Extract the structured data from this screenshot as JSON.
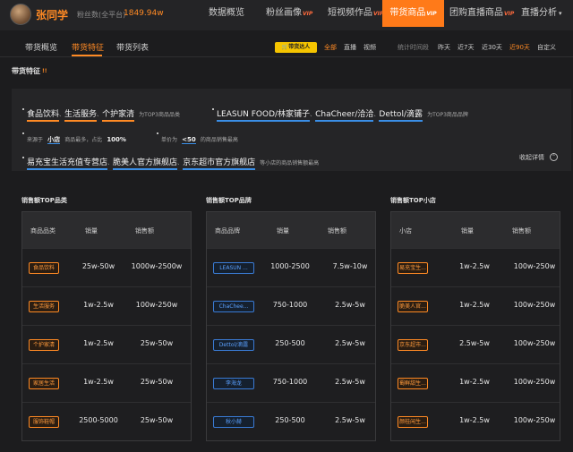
{
  "colors": {
    "accent": "#ff8a24",
    "blue": "#3a8ee6",
    "bg": "#1c1c1e"
  },
  "profile": {
    "name": "张同学",
    "fans_label": "粉丝数(全平台)",
    "fans_value": "1849.94w"
  },
  "nav": {
    "vip": "VIP",
    "items": [
      {
        "label": "数据概览"
      },
      {
        "label": "粉丝画像"
      },
      {
        "label": "短视频作品"
      },
      {
        "label": "带货商品"
      },
      {
        "label": "团购直播商品"
      },
      {
        "label": "直播分析"
      }
    ]
  },
  "subnav": {
    "tabs": [
      "带货概览",
      "带货特征",
      "带货列表"
    ],
    "badge": "带货达人",
    "filters": [
      "全部",
      "直播",
      "视频"
    ],
    "time_label": "统计时间段",
    "times": [
      "昨天",
      "近7天",
      "近30天",
      "近90天",
      "自定义"
    ]
  },
  "section": {
    "title": "带货特征",
    "mark": "!!"
  },
  "features": {
    "line1": {
      "cats": [
        "食品饮料",
        "生活服务",
        "个护家清"
      ],
      "sep": "、",
      "cats_suffix": "为TOP3商品品类",
      "brands": [
        "LEASUN FOOD/林家铺子",
        "ChaCheer/洽洽",
        "Dettol/滴露"
      ],
      "brands_suffix": "为TOP3商品品牌"
    },
    "line2": {
      "source_prefix": "来源于",
      "source_word": "小店",
      "source_mid": "商品最多，占比",
      "source_pct": "100%",
      "price_prefix": "单价为",
      "price": "<50",
      "price_suffix": "的商品销售最高"
    },
    "line3": {
      "shops": [
        "易充宝生活充值专营店",
        "脆美人官方旗舰店",
        "京东超市官方旗舰店"
      ],
      "suffix": "等小店的商品销售额最高"
    },
    "collapse": "收起详情",
    "collapse_icon": "chevron-up-icon"
  },
  "tables": [
    {
      "title": "销售额TOP品类",
      "headers": [
        "商品品类",
        "销量",
        "销售额"
      ],
      "rows": [
        {
          "tag": "食品饮料",
          "sales": "25w-50w",
          "amount": "1000w-2500w"
        },
        {
          "tag": "生活服务",
          "sales": "1w-2.5w",
          "amount": "100w-250w"
        },
        {
          "tag": "个护家清",
          "sales": "1w-2.5w",
          "amount": "25w-50w"
        },
        {
          "tag": "家居生活",
          "sales": "1w-2.5w",
          "amount": "25w-50w"
        },
        {
          "tag": "服饰鞋帽",
          "sales": "2500-5000",
          "amount": "25w-50w"
        }
      ]
    },
    {
      "title": "销售额TOP品牌",
      "headers": [
        "商品品牌",
        "销量",
        "销售额"
      ],
      "rows": [
        {
          "tag": "LEASUN ...",
          "sales": "1000-2500",
          "amount": "7.5w-10w"
        },
        {
          "tag": "ChaChee...",
          "sales": "750-1000",
          "amount": "2.5w-5w"
        },
        {
          "tag": "Dettol/滴露",
          "sales": "250-500",
          "amount": "2.5w-5w"
        },
        {
          "tag": "李海龙",
          "sales": "750-1000",
          "amount": "2.5w-5w"
        },
        {
          "tag": "秋小赫",
          "sales": "250-500",
          "amount": "2.5w-5w"
        }
      ]
    },
    {
      "title": "销售额TOP小店",
      "headers": [
        "小店",
        "销量",
        "销售额"
      ],
      "rows": [
        {
          "tag": "易充宝生...",
          "sales": "1w-2.5w",
          "amount": "100w-250w"
        },
        {
          "tag": "脆美人官...",
          "sales": "1w-2.5w",
          "amount": "100w-250w"
        },
        {
          "tag": "京东超市...",
          "sales": "2.5w-5w",
          "amount": "100w-250w"
        },
        {
          "tag": "蜀鲜甜生...",
          "sales": "1w-2.5w",
          "amount": "100w-250w"
        },
        {
          "tag": "颜桂闲生...",
          "sales": "1w-2.5w",
          "amount": "100w-250w"
        }
      ]
    }
  ]
}
